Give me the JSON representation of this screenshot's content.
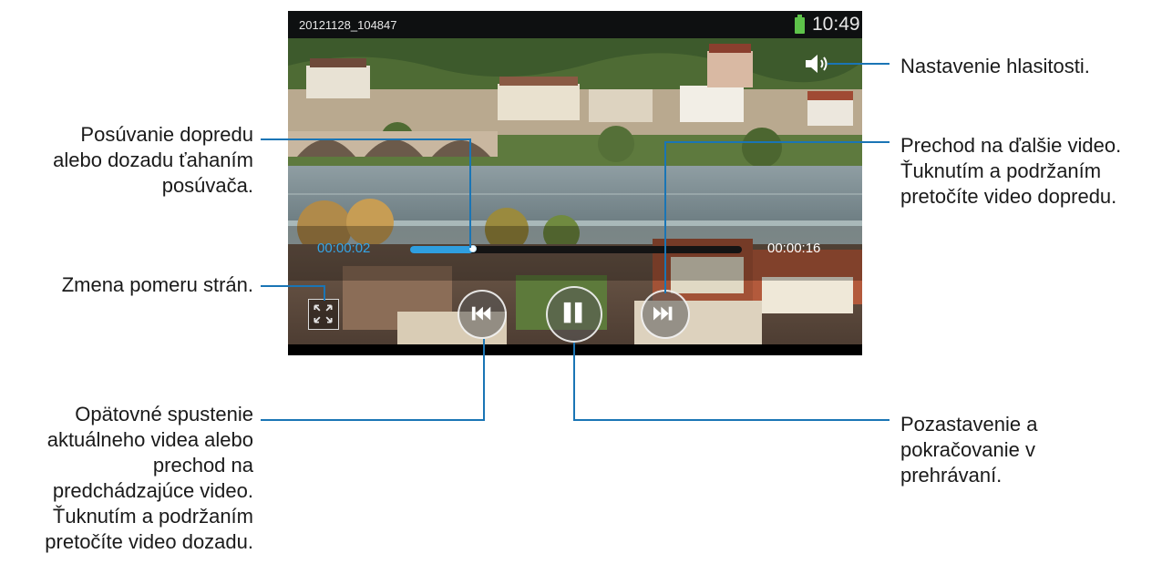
{
  "screen": {
    "file_name": "20121128_104847",
    "clock": "10:49",
    "current_time": "00:00:02",
    "total_time": "00:00:16",
    "progress": 0.19,
    "icons": {
      "volume": "volume-icon",
      "aspect": "aspect-ratio-icon",
      "previous": "previous-track-icon",
      "pause": "pause-icon",
      "next": "next-track-icon",
      "battery": "battery-icon"
    },
    "colors": {
      "accent": "#2f9fe0",
      "battery": "#5ec34a",
      "leader": "#1a75b5"
    }
  },
  "callouts": {
    "seek": "Posúvanie dopredu\nalebo dozadu ťahaním\nposúvača.",
    "aspect": "Zmena pomeru strán.",
    "previous": "Opätovné spustenie\naktuálneho videa alebo\nprechod na\npredchádzajúce video.\nŤuknutím a podržaním\npretočíte video dozadu.",
    "volume": "Nastavenie hlasitosti.",
    "next": "Prechod na ďalšie video.\nŤuknutím a podržaním\npretočíte video dopredu.",
    "pause": "Pozastavenie a\npokračovanie v\nprehrávaní."
  }
}
